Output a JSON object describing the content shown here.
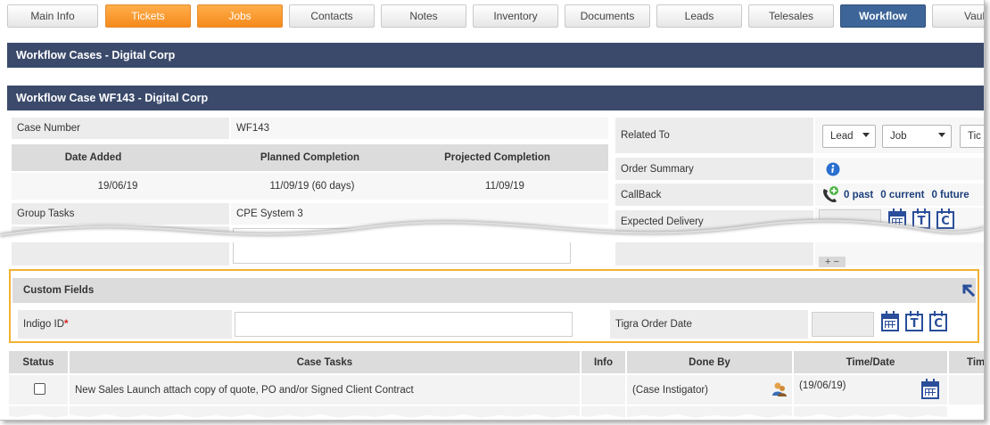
{
  "tabs": [
    {
      "label": "Main Info",
      "style": "normal"
    },
    {
      "label": "Tickets",
      "style": "orange"
    },
    {
      "label": "Jobs",
      "style": "orange"
    },
    {
      "label": "Contacts",
      "style": "normal"
    },
    {
      "label": "Notes",
      "style": "normal"
    },
    {
      "label": "Inventory",
      "style": "normal"
    },
    {
      "label": "Documents",
      "style": "normal"
    },
    {
      "label": "Leads",
      "style": "normal"
    },
    {
      "label": "Telesales",
      "style": "normal"
    },
    {
      "label": "Workflow",
      "style": "active"
    },
    {
      "label": "Vaul",
      "style": "normal"
    }
  ],
  "section_title": "Workflow Cases - Digital Corp",
  "case_title": "Workflow Case WF143 - Digital Corp",
  "left": {
    "case_number_label": "Case Number",
    "case_number_value": "WF143",
    "date_added_header": "Date Added",
    "planned_header": "Planned Completion",
    "projected_header": "Projected Completion",
    "date_added_value": "19/06/19",
    "planned_value": "11/09/19 (60 days)",
    "projected_value": "11/09/19",
    "group_tasks_label": "Group Tasks",
    "group_tasks_value": "CPE System 3"
  },
  "right": {
    "related_to_label": "Related To",
    "related_select_1": "Lead",
    "related_select_2": "Job",
    "related_select_3": "Tic",
    "order_summary_label": "Order Summary",
    "callback_label": "CallBack",
    "callback_past": "0 past",
    "callback_current": "0 current",
    "callback_future": "0 future",
    "expected_delivery_label": "Expected Delivery",
    "plus_minus": "+ −"
  },
  "custom_fields": {
    "title": "Custom Fields",
    "indigo_label": "Indigo ID",
    "required_mark": "*",
    "tigra_label": "Tigra Order Date"
  },
  "calendar_letters": {
    "today": "T",
    "clear": "C"
  },
  "tasks": {
    "headers": {
      "status": "Status",
      "case_tasks": "Case Tasks",
      "info": "Info",
      "done_by": "Done By",
      "time_date": "Time/Date",
      "extra": "Tim"
    },
    "rows": [
      {
        "task": "New Sales Launch attach copy of quote, PO and/or Signed Client Contract",
        "done_by": "(Case Instigator)",
        "time_date": "(19/06/19)"
      }
    ]
  },
  "colors": {
    "header_bar": "#3b4a6b",
    "orange_tab": "#f68a1c",
    "active_tab": "#3d6598",
    "highlight_border": "#f0b233",
    "icon_blue": "#2a4e9a"
  },
  "icons": [
    "info-icon",
    "phone-add-icon",
    "calendar-icon",
    "today-icon",
    "clear-icon",
    "expand-arrow-icon",
    "user-icon"
  ]
}
